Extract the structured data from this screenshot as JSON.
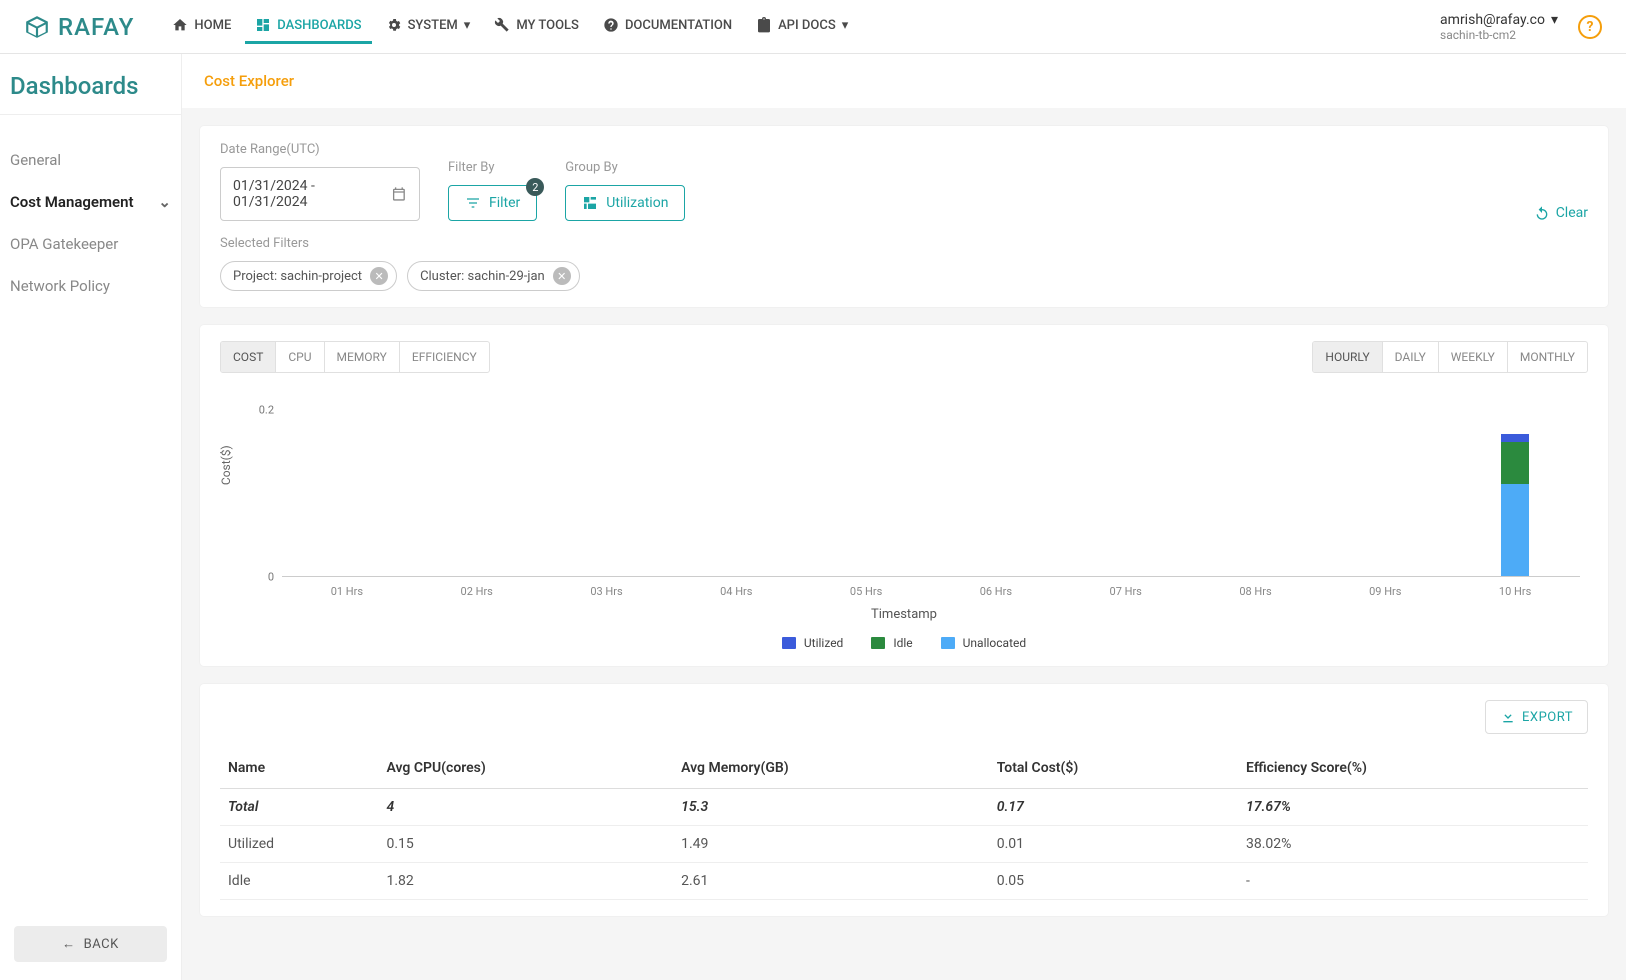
{
  "nav": {
    "brand": "RAFAY",
    "items": [
      {
        "label": "HOME"
      },
      {
        "label": "DASHBOARDS",
        "active": true
      },
      {
        "label": "SYSTEM",
        "caret": true
      },
      {
        "label": "MY TOOLS"
      },
      {
        "label": "DOCUMENTATION"
      },
      {
        "label": "API DOCS",
        "caret": true
      }
    ],
    "user_email": "amrish@rafay.co",
    "tenant": "sachin-tb-cm2"
  },
  "sidebar": {
    "title": "Dashboards",
    "items": [
      {
        "label": "General"
      },
      {
        "label": "Cost Management",
        "active": true,
        "expandable": true
      },
      {
        "label": "OPA Gatekeeper"
      },
      {
        "label": "Network Policy"
      }
    ],
    "back": "BACK"
  },
  "page": {
    "title": "Cost Explorer"
  },
  "filters": {
    "date_label": "Date Range(UTC)",
    "date_value": "01/31/2024 - 01/31/2024",
    "filter_by_label": "Filter By",
    "filter_btn": "Filter",
    "filter_badge": "2",
    "group_by_label": "Group By",
    "group_btn": "Utilization",
    "clear": "Clear",
    "selected_label": "Selected Filters",
    "chips": [
      {
        "label": "Project: sachin-project"
      },
      {
        "label": "Cluster: sachin-29-jan"
      }
    ]
  },
  "chart_tabs_left": [
    {
      "label": "COST",
      "active": true
    },
    {
      "label": "CPU"
    },
    {
      "label": "MEMORY"
    },
    {
      "label": "EFFICIENCY"
    }
  ],
  "chart_tabs_right": [
    {
      "label": "HOURLY",
      "active": true
    },
    {
      "label": "DAILY"
    },
    {
      "label": "WEEKLY"
    },
    {
      "label": "MONTHLY"
    }
  ],
  "chart_data": {
    "type": "bar",
    "title": "",
    "xlabel": "Timestamp",
    "ylabel": "Cost($)",
    "ylim": [
      0,
      0.22
    ],
    "yticks": [
      0,
      0.2
    ],
    "categories": [
      "01 Hrs",
      "02 Hrs",
      "03 Hrs",
      "04 Hrs",
      "05 Hrs",
      "06 Hrs",
      "07 Hrs",
      "08 Hrs",
      "09 Hrs",
      "10 Hrs"
    ],
    "series": [
      {
        "name": "Utilized",
        "color": "#3b5bdb",
        "values": [
          0,
          0,
          0,
          0,
          0,
          0,
          0,
          0,
          0,
          0.01
        ]
      },
      {
        "name": "Idle",
        "color": "#2b8a3e",
        "values": [
          0,
          0,
          0,
          0,
          0,
          0,
          0,
          0,
          0,
          0.05
        ]
      },
      {
        "name": "Unallocated",
        "color": "#4dabf7",
        "values": [
          0,
          0,
          0,
          0,
          0,
          0,
          0,
          0,
          0,
          0.11
        ]
      }
    ]
  },
  "table": {
    "export": "EXPORT",
    "columns": [
      "Name",
      "Avg CPU(cores)",
      "Avg Memory(GB)",
      "Total Cost($)",
      "Efficiency Score(%)"
    ],
    "rows": [
      {
        "cells": [
          "Total",
          "4",
          "15.3",
          "0.17",
          "17.67%"
        ],
        "total": true
      },
      {
        "cells": [
          "Utilized",
          "0.15",
          "1.49",
          "0.01",
          "38.02%"
        ]
      },
      {
        "cells": [
          "Idle",
          "1.82",
          "2.61",
          "0.05",
          "-"
        ]
      }
    ]
  }
}
